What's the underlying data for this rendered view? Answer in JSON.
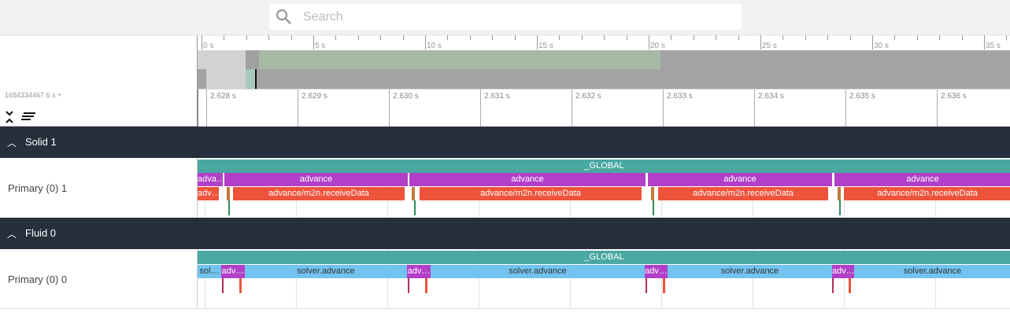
{
  "search": {
    "placeholder": "Search",
    "icon": "search-icon"
  },
  "overview": {
    "labels": [
      "0 s",
      "5 s",
      "10 s",
      "15 s",
      "20 s",
      "25 s",
      "30 s",
      "35 s"
    ]
  },
  "timeline": {
    "base": "1684334467.6 s +",
    "labels": [
      "2.628 s",
      "2.629 s",
      "2.630 s",
      "2.631 s",
      "2.632 s",
      "2.633 s",
      "2.634 s",
      "2.635 s",
      "2.636 s"
    ]
  },
  "groups": [
    {
      "name": "Solid 1",
      "track": "Primary (0) 1",
      "global": "_GLOBAL",
      "advance": [
        "adva…",
        "advance",
        "advance",
        "advance",
        "advance"
      ],
      "receive": [
        "adv…",
        "advance/m2n.receiveData",
        "advance/m2n.receiveData",
        "advance/m2n.receiveData",
        "advance/m2n.receiveData"
      ]
    },
    {
      "name": "Fluid 0",
      "track": "Primary (0) 0",
      "global": "_GLOBAL",
      "slices": [
        "sol…",
        "adv…",
        "solver.advance",
        "adv…",
        "solver.advance",
        "adv…",
        "solver.advance",
        "adv…",
        "solver.advance"
      ]
    }
  ],
  "colors": {
    "global": "#4aa8a3",
    "advance": "#b13fc8",
    "receive": "#ee533b",
    "solver": "#72c3ef",
    "group_header": "#262f3c"
  }
}
